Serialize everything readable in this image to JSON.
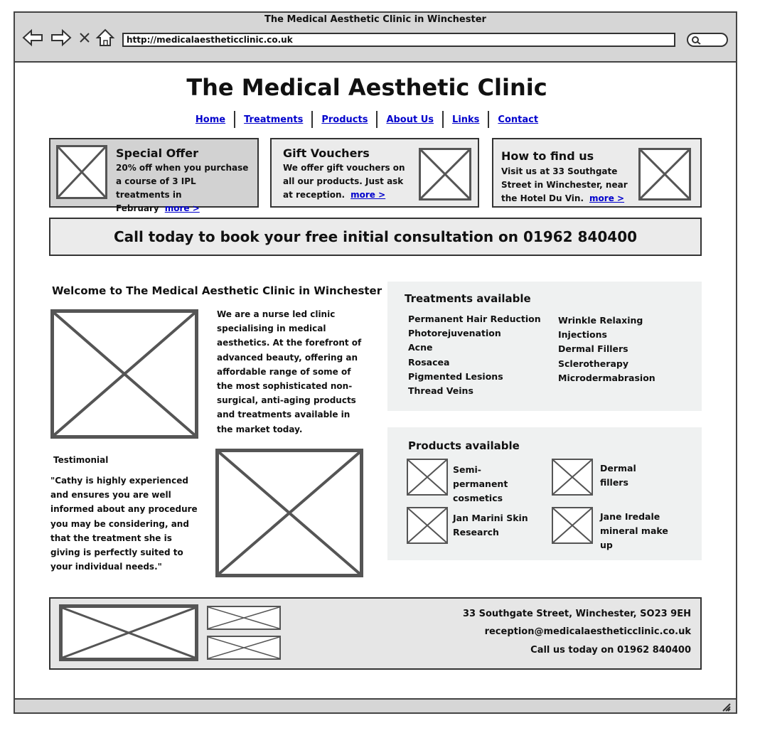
{
  "browser": {
    "window_title": "The Medical Aesthetic Clinic in Winchester",
    "url": "http://medicalaestheticclinic.co.uk"
  },
  "site": {
    "title": "The Medical Aesthetic Clinic",
    "nav": [
      "Home",
      "Treatments",
      "Products",
      "About Us",
      "Links",
      "Contact"
    ]
  },
  "promos": [
    {
      "title": "Special Offer",
      "text": "20% off when you purchase a course of 3 IPL treatments in February",
      "more": "more >"
    },
    {
      "title": "Gift Vouchers",
      "text": "We offer gift vouchers on all our products. Just ask at reception.",
      "more": "more >"
    },
    {
      "title": "How to find us",
      "text": "Visit us at 33 Southgate Street in Winchester, near the Hotel Du Vin.",
      "more": "more >"
    }
  ],
  "cta": "Call today to book your free initial consultation on 01962 840400",
  "welcome": {
    "title": "Welcome to The Medical Aesthetic Clinic in Winchester",
    "intro": "We are a nurse led clinic specialising in medical aesthetics. At the forefront of advanced beauty, offering an affordable range of some of the most sophisticated non-surgical, anti-aging products and treatments available in the market today.",
    "testimonial_label": "Testimonial",
    "testimonial": "\"Cathy is highly experienced and ensures you are well informed about any procedure you may be considering, and that the treatment she is giving is perfectly suited to your individual needs.\""
  },
  "treatments": {
    "title": "Treatments available",
    "col1": [
      "Permanent Hair Reduction",
      "Photorejuvenation",
      "Acne",
      "Rosacea",
      "Pigmented Lesions",
      "Thread Veins"
    ],
    "col2": [
      "Wrinkle Relaxing Injections",
      "Dermal Fillers",
      "Sclerotherapy",
      "Microdermabrasion"
    ]
  },
  "products": {
    "title": "Products available",
    "items": [
      "Semi-permanent cosmetics",
      "Dermal fillers",
      "Jan Marini Skin Research",
      "Jane Iredale mineral make up"
    ]
  },
  "footer": {
    "address": "33 Southgate Street, Winchester, SO23 9EH",
    "email": "reception@medicalaestheticclinic.co.uk",
    "phone": "Call us today on 01962 840400"
  }
}
